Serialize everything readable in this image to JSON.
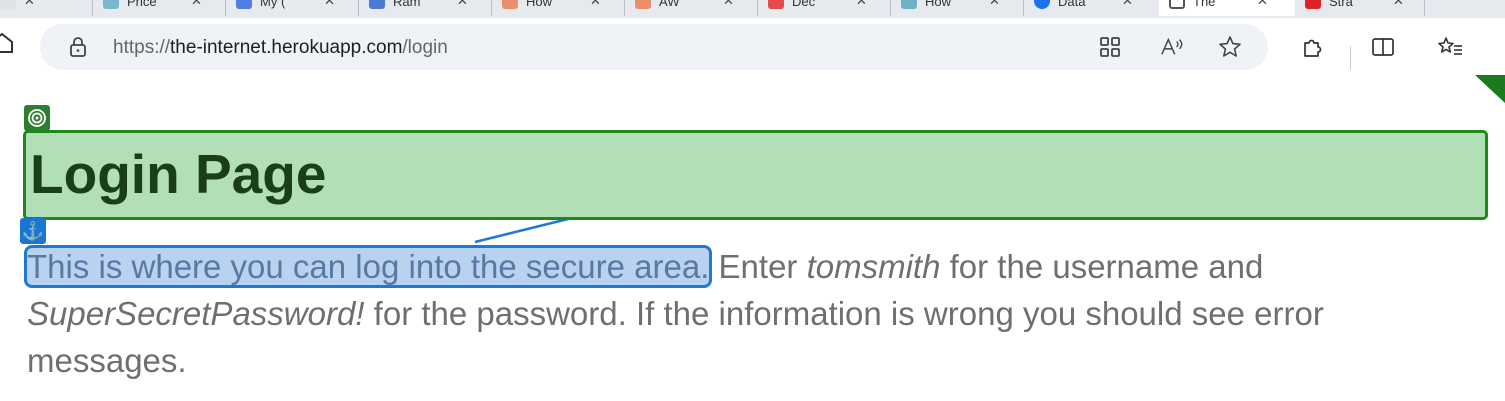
{
  "browser": {
    "tabs": [
      {
        "favicon_color": "#7ab8c9",
        "label": "Price"
      },
      {
        "favicon_color": "#4f7fe0",
        "label": "My ("
      },
      {
        "favicon_color": "#4a7bd1",
        "label": "Ram"
      },
      {
        "favicon_color": "#e98f6a",
        "label": "How"
      },
      {
        "favicon_color": "#e98f6a",
        "label": "AW"
      },
      {
        "favicon_color": "#e44a4a",
        "label": "Dec"
      },
      {
        "favicon_color": "#6db0c9",
        "label": "How"
      },
      {
        "favicon_color": "#1a73e8",
        "label": "Data"
      },
      {
        "favicon_color": "#666666",
        "label": "The"
      },
      {
        "favicon_color": "#e0212a",
        "label": "Stra"
      }
    ],
    "close_glyph": "✕",
    "address": {
      "scheme": "https://",
      "host": "the-internet.herokuapp.com",
      "path": "/login"
    },
    "icons": {
      "site_info": "lock-icon",
      "apps": "apps-grid-icon",
      "read_aloud": "read-aloud-icon",
      "favorite": "star-icon",
      "extensions": "puzzle-icon",
      "split": "split-screen-icon",
      "favorites": "favorites-list-icon"
    }
  },
  "page": {
    "heading": "Login Page",
    "description": {
      "highlighted": "This is where you can log into the secure area.",
      "part1": " Enter ",
      "username": "tomsmith",
      "part2": " for the username and ",
      "password": "SuperSecretPassword!",
      "part3": " for the password. If the information is wrong you should see error messages."
    }
  },
  "overlay": {
    "heading_badge_color": "#2e7d32",
    "anchor_badge_color": "#1976d2",
    "heading_box_color": "#b2dfb5",
    "highlight_color": "#b9d2f0"
  }
}
